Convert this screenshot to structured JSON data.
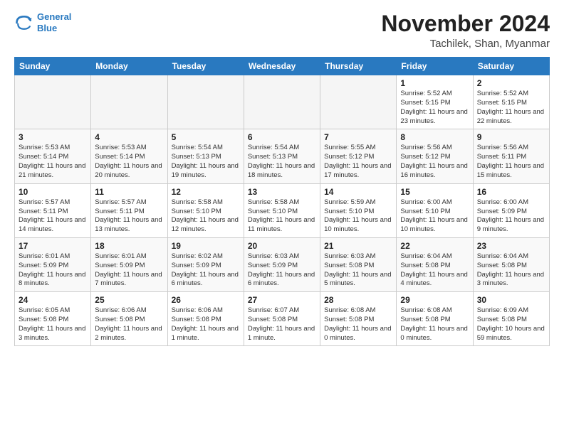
{
  "header": {
    "logo_line1": "General",
    "logo_line2": "Blue",
    "month": "November 2024",
    "location": "Tachilek, Shan, Myanmar"
  },
  "days_of_week": [
    "Sunday",
    "Monday",
    "Tuesday",
    "Wednesday",
    "Thursday",
    "Friday",
    "Saturday"
  ],
  "weeks": [
    [
      {
        "day": "",
        "empty": true
      },
      {
        "day": "",
        "empty": true
      },
      {
        "day": "",
        "empty": true
      },
      {
        "day": "",
        "empty": true
      },
      {
        "day": "",
        "empty": true
      },
      {
        "day": "1",
        "sunrise": "5:52 AM",
        "sunset": "5:15 PM",
        "daylight": "11 hours and 23 minutes."
      },
      {
        "day": "2",
        "sunrise": "5:52 AM",
        "sunset": "5:15 PM",
        "daylight": "11 hours and 22 minutes."
      }
    ],
    [
      {
        "day": "3",
        "sunrise": "5:53 AM",
        "sunset": "5:14 PM",
        "daylight": "11 hours and 21 minutes."
      },
      {
        "day": "4",
        "sunrise": "5:53 AM",
        "sunset": "5:14 PM",
        "daylight": "11 hours and 20 minutes."
      },
      {
        "day": "5",
        "sunrise": "5:54 AM",
        "sunset": "5:13 PM",
        "daylight": "11 hours and 19 minutes."
      },
      {
        "day": "6",
        "sunrise": "5:54 AM",
        "sunset": "5:13 PM",
        "daylight": "11 hours and 18 minutes."
      },
      {
        "day": "7",
        "sunrise": "5:55 AM",
        "sunset": "5:12 PM",
        "daylight": "11 hours and 17 minutes."
      },
      {
        "day": "8",
        "sunrise": "5:56 AM",
        "sunset": "5:12 PM",
        "daylight": "11 hours and 16 minutes."
      },
      {
        "day": "9",
        "sunrise": "5:56 AM",
        "sunset": "5:11 PM",
        "daylight": "11 hours and 15 minutes."
      }
    ],
    [
      {
        "day": "10",
        "sunrise": "5:57 AM",
        "sunset": "5:11 PM",
        "daylight": "11 hours and 14 minutes."
      },
      {
        "day": "11",
        "sunrise": "5:57 AM",
        "sunset": "5:11 PM",
        "daylight": "11 hours and 13 minutes."
      },
      {
        "day": "12",
        "sunrise": "5:58 AM",
        "sunset": "5:10 PM",
        "daylight": "11 hours and 12 minutes."
      },
      {
        "day": "13",
        "sunrise": "5:58 AM",
        "sunset": "5:10 PM",
        "daylight": "11 hours and 11 minutes."
      },
      {
        "day": "14",
        "sunrise": "5:59 AM",
        "sunset": "5:10 PM",
        "daylight": "11 hours and 10 minutes."
      },
      {
        "day": "15",
        "sunrise": "6:00 AM",
        "sunset": "5:10 PM",
        "daylight": "11 hours and 10 minutes."
      },
      {
        "day": "16",
        "sunrise": "6:00 AM",
        "sunset": "5:09 PM",
        "daylight": "11 hours and 9 minutes."
      }
    ],
    [
      {
        "day": "17",
        "sunrise": "6:01 AM",
        "sunset": "5:09 PM",
        "daylight": "11 hours and 8 minutes."
      },
      {
        "day": "18",
        "sunrise": "6:01 AM",
        "sunset": "5:09 PM",
        "daylight": "11 hours and 7 minutes."
      },
      {
        "day": "19",
        "sunrise": "6:02 AM",
        "sunset": "5:09 PM",
        "daylight": "11 hours and 6 minutes."
      },
      {
        "day": "20",
        "sunrise": "6:03 AM",
        "sunset": "5:09 PM",
        "daylight": "11 hours and 6 minutes."
      },
      {
        "day": "21",
        "sunrise": "6:03 AM",
        "sunset": "5:08 PM",
        "daylight": "11 hours and 5 minutes."
      },
      {
        "day": "22",
        "sunrise": "6:04 AM",
        "sunset": "5:08 PM",
        "daylight": "11 hours and 4 minutes."
      },
      {
        "day": "23",
        "sunrise": "6:04 AM",
        "sunset": "5:08 PM",
        "daylight": "11 hours and 3 minutes."
      }
    ],
    [
      {
        "day": "24",
        "sunrise": "6:05 AM",
        "sunset": "5:08 PM",
        "daylight": "11 hours and 3 minutes."
      },
      {
        "day": "25",
        "sunrise": "6:06 AM",
        "sunset": "5:08 PM",
        "daylight": "11 hours and 2 minutes."
      },
      {
        "day": "26",
        "sunrise": "6:06 AM",
        "sunset": "5:08 PM",
        "daylight": "11 hours and 1 minute."
      },
      {
        "day": "27",
        "sunrise": "6:07 AM",
        "sunset": "5:08 PM",
        "daylight": "11 hours and 1 minute."
      },
      {
        "day": "28",
        "sunrise": "6:08 AM",
        "sunset": "5:08 PM",
        "daylight": "11 hours and 0 minutes."
      },
      {
        "day": "29",
        "sunrise": "6:08 AM",
        "sunset": "5:08 PM",
        "daylight": "11 hours and 0 minutes."
      },
      {
        "day": "30",
        "sunrise": "6:09 AM",
        "sunset": "5:08 PM",
        "daylight": "10 hours and 59 minutes."
      }
    ]
  ]
}
